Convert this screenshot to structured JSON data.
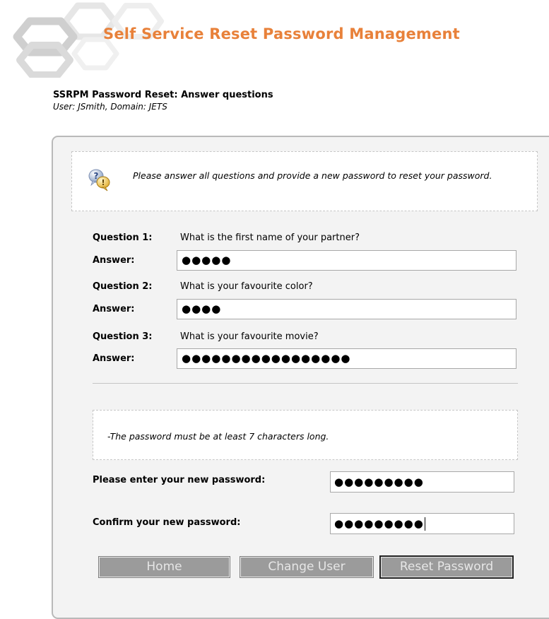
{
  "header": {
    "app_title": "Self Service Reset Password Management",
    "logo_icon": "hexagon-logo-icon"
  },
  "page": {
    "heading": "SSRPM Password Reset: Answer questions",
    "subheading": "User: JSmith, Domain: JETS"
  },
  "info": {
    "icon": "help-question-icon",
    "text": "Please answer all questions and provide a new password to reset your password."
  },
  "questions": [
    {
      "label": "Question 1:",
      "text": "What is the first name of your partner?",
      "answer_label": "Answer:",
      "answer_value": "●●●●●"
    },
    {
      "label": "Question 2:",
      "text": "What is your favourite color?",
      "answer_label": "Answer:",
      "answer_value": "●●●●"
    },
    {
      "label": "Question 3:",
      "text": "What is your favourite movie?",
      "answer_label": "Answer:",
      "answer_value": "●●●●●●●●●●●●●●●●●"
    }
  ],
  "rules": {
    "text": "-The password must be at least 7 characters long."
  },
  "new_password": {
    "label": "Please enter your new password:",
    "value": "●●●●●●●●●"
  },
  "confirm_password": {
    "label": "Confirm your new password:",
    "value": "●●●●●●●●●"
  },
  "buttons": {
    "home": "Home",
    "change_user": "Change User",
    "reset_password": "Reset Password"
  },
  "colors": {
    "title_orange": "#e8813a",
    "button_gray": "#9b9b9b",
    "panel_bg": "#f3f3f3"
  }
}
